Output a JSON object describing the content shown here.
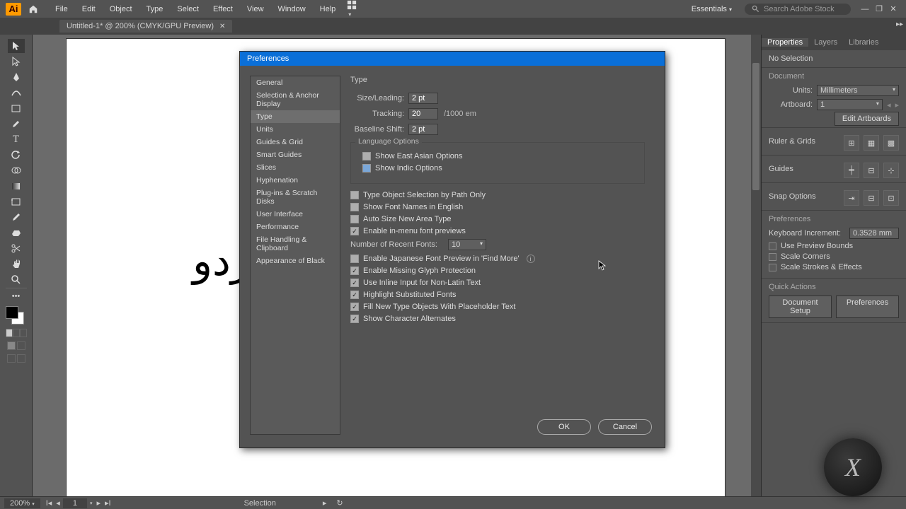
{
  "menubar": {
    "logo": "Ai",
    "items": [
      "File",
      "Edit",
      "Object",
      "Type",
      "Select",
      "Effect",
      "View",
      "Window",
      "Help"
    ],
    "workspace": "Essentials",
    "search_placeholder": "Search Adobe Stock"
  },
  "tab": {
    "label": "Untitled-1* @ 200% (CMYK/GPU Preview)"
  },
  "canvas_text": "اردو",
  "status": {
    "zoom": "200%",
    "artboard": "1",
    "tool": "Selection"
  },
  "right": {
    "tabs": [
      "Properties",
      "Layers",
      "Libraries"
    ],
    "selection": "No Selection",
    "doc_hdr": "Document",
    "units_label": "Units:",
    "units_value": "Millimeters",
    "artboard_label": "Artboard:",
    "artboard_value": "1",
    "edit_artboards": "Edit Artboards",
    "ruler_hdr": "Ruler & Grids",
    "guides_hdr": "Guides",
    "snap_hdr": "Snap Options",
    "prefs_hdr": "Preferences",
    "kb_inc_label": "Keyboard Increment:",
    "kb_inc_value": "0.3528 mm",
    "checks": [
      "Use Preview Bounds",
      "Scale Corners",
      "Scale Strokes & Effects"
    ],
    "qa_hdr": "Quick Actions",
    "qa_btns": [
      "Document Setup",
      "Preferences"
    ]
  },
  "dialog": {
    "title": "Preferences",
    "categories": [
      "General",
      "Selection & Anchor Display",
      "Type",
      "Units",
      "Guides & Grid",
      "Smart Guides",
      "Slices",
      "Hyphenation",
      "Plug-ins & Scratch Disks",
      "User Interface",
      "Performance",
      "File Handling & Clipboard",
      "Appearance of Black"
    ],
    "active_category": "Type",
    "section_title": "Type",
    "size_leading_label": "Size/Leading:",
    "size_leading_value": "2 pt",
    "tracking_label": "Tracking:",
    "tracking_value": "20",
    "tracking_suffix": "/1000 em",
    "baseline_label": "Baseline Shift:",
    "baseline_value": "2 pt",
    "lang_group": "Language Options",
    "show_east_asian": "Show East Asian Options",
    "show_indic": "Show Indic Options",
    "checks": [
      {
        "label": "Type Object Selection by Path Only",
        "checked": false
      },
      {
        "label": "Show Font Names in English",
        "checked": false
      },
      {
        "label": "Auto Size New Area Type",
        "checked": false
      },
      {
        "label": "Enable in-menu font previews",
        "checked": true
      }
    ],
    "recent_fonts_label": "Number of Recent Fonts:",
    "recent_fonts_value": "10",
    "checks2": [
      {
        "label": "Enable Japanese Font Preview in 'Find More'",
        "checked": false,
        "info": true
      },
      {
        "label": "Enable Missing Glyph Protection",
        "checked": true
      },
      {
        "label": "Use Inline Input for Non-Latin Text",
        "checked": true
      },
      {
        "label": "Highlight Substituted Fonts",
        "checked": true
      },
      {
        "label": "Fill New Type Objects With Placeholder Text",
        "checked": true
      },
      {
        "label": "Show Character Alternates",
        "checked": true
      }
    ],
    "ok": "OK",
    "cancel": "Cancel"
  }
}
